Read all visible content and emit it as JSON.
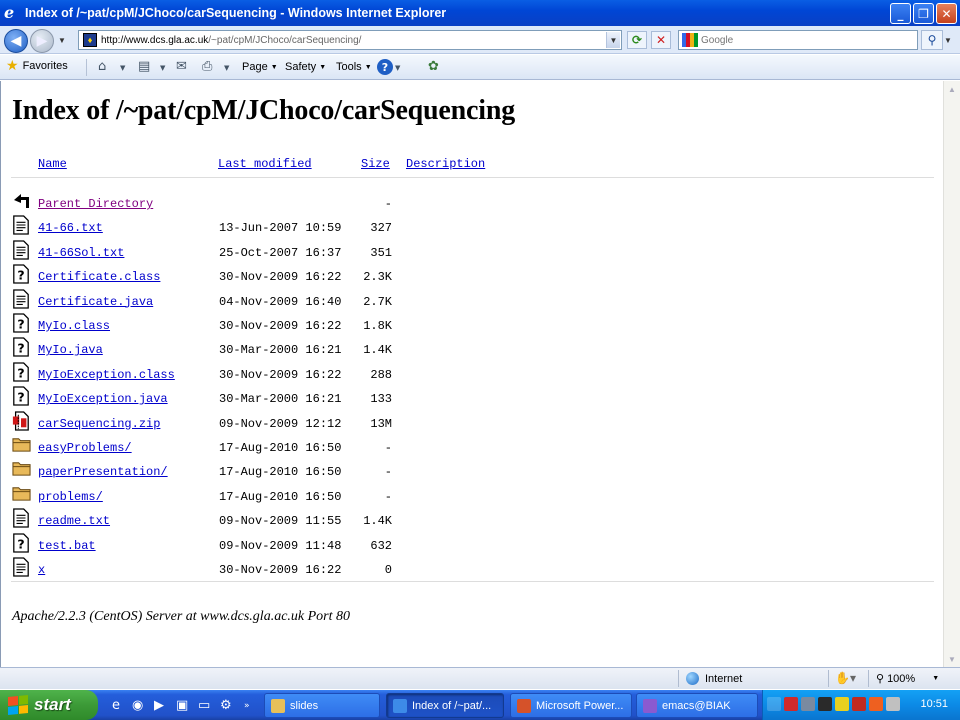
{
  "window": {
    "title": "Index of /~pat/cpM/JChoco/carSequencing - Windows Internet Explorer",
    "minimize": "_",
    "maximize": "❐",
    "close": "✕"
  },
  "address": {
    "host": "http://www.dcs.gla.ac.uk",
    "path": "/~pat/cpM/JChoco/carSequencing/"
  },
  "search": {
    "placeholder": "Google"
  },
  "commandbar": {
    "favorites": "Favorites",
    "page": "Page",
    "safety": "Safety",
    "tools": "Tools"
  },
  "page": {
    "heading": "Index of /~pat/cpM/JChoco/carSequencing",
    "columns": {
      "name": "Name",
      "modified": "Last modified",
      "size": "Size",
      "description": "Description"
    },
    "entries": [
      {
        "icon": "back-icon",
        "name": "Parent Directory",
        "date": "",
        "size": "-",
        "visited": true
      },
      {
        "icon": "text-file-icon",
        "name": "41-66.txt",
        "date": "13-Jun-2007 10:59",
        "size": "327"
      },
      {
        "icon": "text-file-icon",
        "name": "41-66Sol.txt",
        "date": "25-Oct-2007 16:37",
        "size": "351"
      },
      {
        "icon": "unknown-file-icon",
        "name": "Certificate.class",
        "date": "30-Nov-2009 16:22",
        "size": "2.3K"
      },
      {
        "icon": "text-file-icon",
        "name": "Certificate.java",
        "date": "04-Nov-2009 16:40",
        "size": "2.7K"
      },
      {
        "icon": "unknown-file-icon",
        "name": "MyIo.class",
        "date": "30-Nov-2009 16:22",
        "size": "1.8K"
      },
      {
        "icon": "unknown-file-icon",
        "name": "MyIo.java",
        "date": "30-Mar-2000 16:21",
        "size": "1.4K"
      },
      {
        "icon": "unknown-file-icon",
        "name": "MyIoException.class",
        "date": "30-Nov-2009 16:22",
        "size": "288"
      },
      {
        "icon": "unknown-file-icon",
        "name": "MyIoException.java",
        "date": "30-Mar-2000 16:21",
        "size": "133"
      },
      {
        "icon": "compressed-file-icon",
        "name": "carSequencing.zip",
        "date": "09-Nov-2009 12:12",
        "size": "13M"
      },
      {
        "icon": "folder-icon",
        "name": "easyProblems/",
        "date": "17-Aug-2010 16:50",
        "size": "-"
      },
      {
        "icon": "folder-icon",
        "name": "paperPresentation/",
        "date": "17-Aug-2010 16:50",
        "size": "-"
      },
      {
        "icon": "folder-icon",
        "name": "problems/",
        "date": "17-Aug-2010 16:50",
        "size": "-"
      },
      {
        "icon": "text-file-icon",
        "name": "readme.txt",
        "date": "09-Nov-2009 11:55",
        "size": "1.4K"
      },
      {
        "icon": "unknown-file-icon",
        "name": "test.bat",
        "date": "09-Nov-2009 11:48",
        "size": "632"
      },
      {
        "icon": "text-file-icon",
        "name": "x",
        "date": "30-Nov-2009 16:22",
        "size": "0"
      }
    ],
    "footer": "Apache/2.2.3 (CentOS) Server at www.dcs.gla.ac.uk Port 80"
  },
  "statusbar": {
    "zone": "Internet",
    "zoom": "100%"
  },
  "taskbar": {
    "start": "start",
    "tasks": [
      {
        "label": "slides",
        "color": "#e8c05a"
      },
      {
        "label": "Index of /~pat/...",
        "color": "#3d8be8"
      },
      {
        "label": "Microsoft Power...",
        "color": "#d5522a"
      },
      {
        "label": "emacs@BIAK",
        "color": "#8a5ad0"
      }
    ],
    "clock": "10:51"
  }
}
